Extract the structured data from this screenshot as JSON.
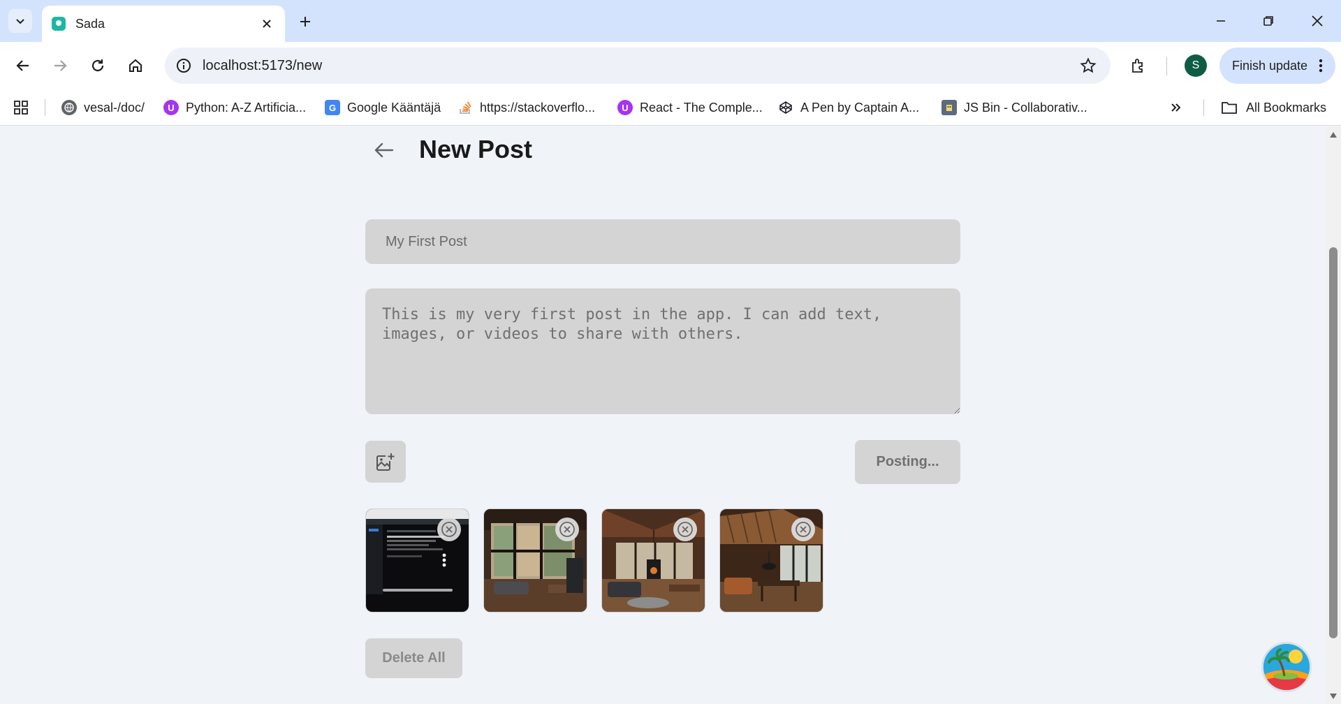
{
  "browser": {
    "tab_title": "Sada",
    "url": "localhost:5173/new",
    "avatar_letter": "S",
    "finish_update_label": "Finish update",
    "bookmarks": [
      {
        "label": "vesal-/doc/",
        "icon": "globe-icon",
        "color": "#5f6368"
      },
      {
        "label": "Python: A-Z Artificia...",
        "icon": "udemy-icon",
        "color": "#a435f0"
      },
      {
        "label": "Google Kääntäjä",
        "icon": "translate-icon",
        "color": "#4285f4"
      },
      {
        "label": "https://stackoverflo...",
        "icon": "stackoverflow-icon",
        "color": "#f48024"
      },
      {
        "label": "React - The Comple...",
        "icon": "udemy-icon",
        "color": "#a435f0"
      },
      {
        "label": "A Pen by Captain A...",
        "icon": "codepen-icon",
        "color": "#1e1f26"
      },
      {
        "label": "JS Bin - Collaborativ...",
        "icon": "jsbin-icon",
        "color": "#5a6b7f"
      }
    ],
    "all_bookmarks_label": "All Bookmarks"
  },
  "page": {
    "title": "New Post",
    "title_input_placeholder": "My First Post",
    "body_placeholder": "This is my very first post in the app. I can add text, images, or videos to share with others.",
    "post_button_label": "Posting...",
    "delete_all_label": "Delete All",
    "thumbnails": [
      {
        "name": "screenshot-thumbnail",
        "alt": "app screenshot"
      },
      {
        "name": "cabin-window-thumbnail",
        "alt": "cabin living room with windows"
      },
      {
        "name": "cabin-fireplace-thumbnail",
        "alt": "cabin interior with stove"
      },
      {
        "name": "cabin-dining-thumbnail",
        "alt": "cabin dining area"
      }
    ]
  },
  "colors": {
    "tabstrip": "#d3e3fd",
    "page_bg": "#f0f3f8",
    "field_bg": "#d4d4d4",
    "avatar": "#0f5c45"
  }
}
